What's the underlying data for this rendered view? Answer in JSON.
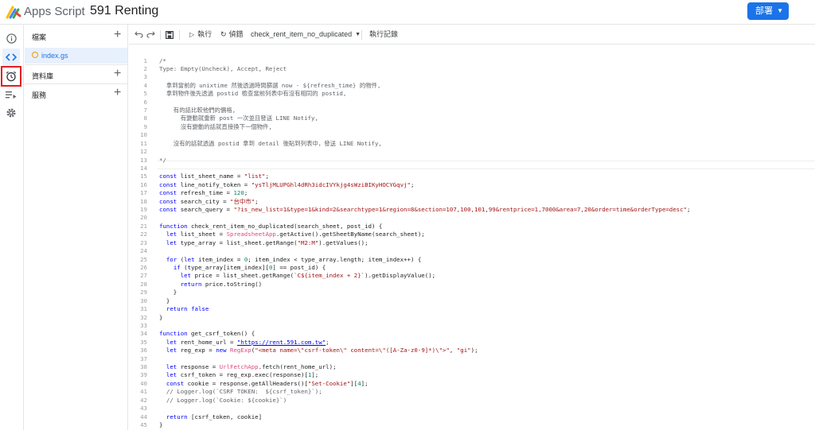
{
  "header": {
    "app_name": "Apps Script",
    "project_title": "591 Renting",
    "deploy_label": "部署"
  },
  "files_panel": {
    "files_label": "檔案",
    "file_name": "index.gs",
    "libraries_label": "資料庫",
    "services_label": "服務"
  },
  "toolbar": {
    "run_label": "執行",
    "debug_label": "偵錯",
    "function_name": "check_rent_item_no_duplicated",
    "log_label": "執行記錄"
  },
  "code": [
    {
      "n": "1",
      "t": "/*"
    },
    {
      "n": "2",
      "t": "Type: Empty(Uncheck), Accept, Reject"
    },
    {
      "n": "3",
      "t": ""
    },
    {
      "n": "4",
      "t": "  拿到當前的 unixtime 然後透過時間篩選 now - ${refresh_time} 的物件,"
    },
    {
      "n": "5",
      "t": "  拿到物件後先透過 postid 檢查當前列表中有沒有相同的 postid,"
    },
    {
      "n": "6",
      "t": ""
    },
    {
      "n": "7",
      "t": "    有的話比較他們的價格,"
    },
    {
      "n": "8",
      "t": "      有變動就重新 post 一次並且發送 LINE Notify,"
    },
    {
      "n": "9",
      "t": "      沒有變動的話就直接換下一個物件,"
    },
    {
      "n": "10",
      "t": ""
    },
    {
      "n": "11",
      "t": "    沒有的話就透過 postid 拿到 detail 後貼到列表中，發送 LINE Notify,"
    },
    {
      "n": "12",
      "t": ""
    },
    {
      "n": "13",
      "t": "*/"
    },
    {
      "n": "14",
      "t": ""
    },
    {
      "n": "15",
      "t": "const list_sheet_name = \"list\";"
    },
    {
      "n": "16",
      "t": "const line_notify_token = \"ysTljMLUPGhl4dRh3idcIVYkjg4sWziBIKyHOCYGqvj\";"
    },
    {
      "n": "17",
      "t": "const refresh_time = 120;"
    },
    {
      "n": "18",
      "t": "const search_city = \"台中市\";"
    },
    {
      "n": "19",
      "t": "const search_query = \"?is_new_list=1&type=1&kind=2&searchtype=1&region=8&section=107,100,101,99&rentprice=1,7000&area=7,20&order=time&orderType=desc\";"
    },
    {
      "n": "20",
      "t": ""
    },
    {
      "n": "21",
      "t": "function check_rent_item_no_duplicated(search_sheet, post_id) {"
    },
    {
      "n": "22",
      "t": "  let list_sheet = SpreadsheetApp.getActive().getSheetByName(search_sheet);"
    },
    {
      "n": "23",
      "t": "  let type_array = list_sheet.getRange(\"M2:M\").getValues();"
    },
    {
      "n": "24",
      "t": ""
    },
    {
      "n": "25",
      "t": "  for (let item_index = 0; item_index < type_array.length; item_index++) {"
    },
    {
      "n": "26",
      "t": "    if (type_array[item_index][0] == post_id) {"
    },
    {
      "n": "27",
      "t": "      let price = list_sheet.getRange(`C${item_index + 2}`).getDisplayValue();"
    },
    {
      "n": "28",
      "t": "      return price.toString()"
    },
    {
      "n": "29",
      "t": "    }"
    },
    {
      "n": "30",
      "t": "  }"
    },
    {
      "n": "31",
      "t": "  return false"
    },
    {
      "n": "32",
      "t": "}"
    },
    {
      "n": "33",
      "t": ""
    },
    {
      "n": "34",
      "t": "function get_csrf_token() {"
    },
    {
      "n": "35",
      "t": "  let rent_home_url = \"https://rent.591.com.tw\";"
    },
    {
      "n": "36",
      "t": "  let reg_exp = new RegExp(\"<meta name=\\\"csrf-token\\\" content=\\\"([A-Za-z0-9]*)\\\">\", \"gi\");"
    },
    {
      "n": "37",
      "t": ""
    },
    {
      "n": "38",
      "t": "  let response = UrlFetchApp.fetch(rent_home_url);"
    },
    {
      "n": "39",
      "t": "  let csrf_token = reg_exp.exec(response)[1];"
    },
    {
      "n": "40",
      "t": "  const cookie = response.getAllHeaders()[\"Set-Cookie\"][4];"
    },
    {
      "n": "41",
      "t": "  // Logger.log(`CSRF TOKEN:  ${csrf_token}`);"
    },
    {
      "n": "42",
      "t": "  // Logger.log(`Cookie: ${cookie}`)"
    },
    {
      "n": "43",
      "t": ""
    },
    {
      "n": "44",
      "t": "  return [csrf_token, cookie]"
    },
    {
      "n": "45",
      "t": "}"
    }
  ]
}
